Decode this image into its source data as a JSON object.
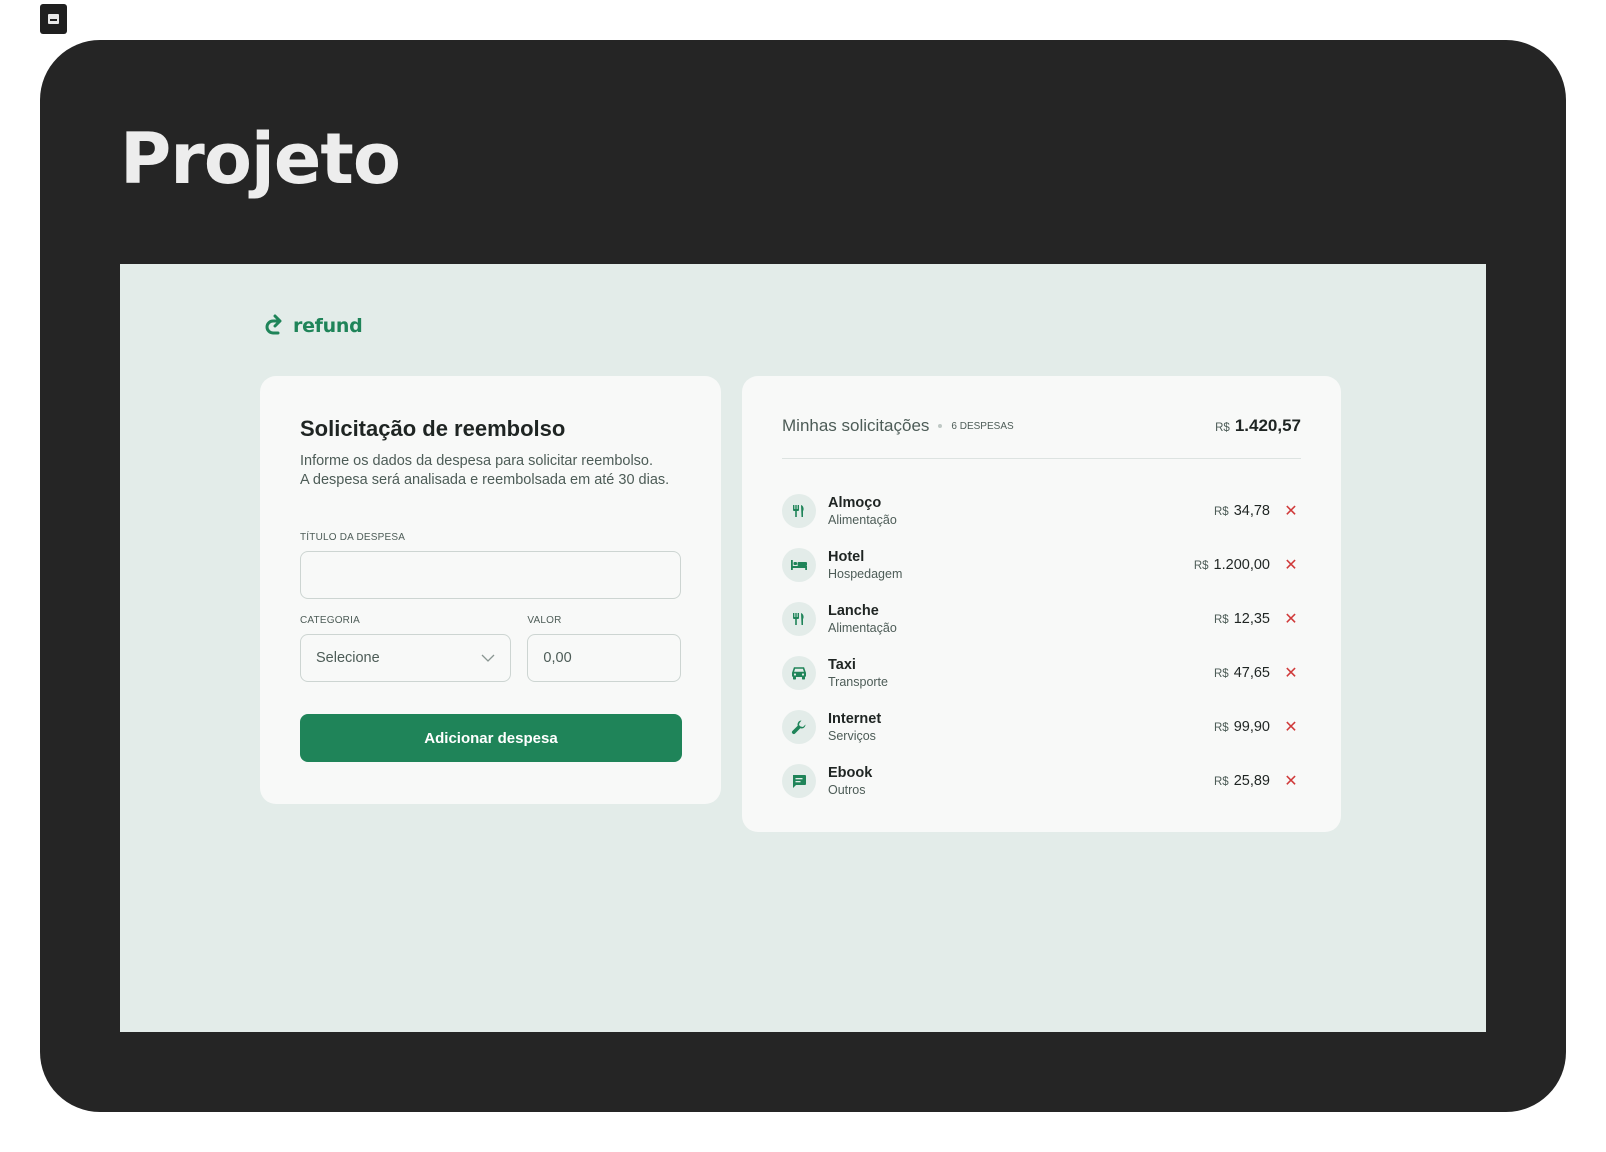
{
  "page": {
    "heading": "Projeto"
  },
  "app": {
    "brand": "refund",
    "accent": "#1f8459"
  },
  "form": {
    "title": "Solicitação de reembolso",
    "description_line1": "Informe os dados da despesa para solicitar reembolso.",
    "description_line2": "A despesa será analisada e reembolsada em até 30 dias.",
    "title_label": "TÍTULO DA DESPESA",
    "title_value": "",
    "category_label": "CATEGORIA",
    "category_value": "Selecione",
    "amount_label": "VALOR",
    "amount_placeholder": "0,00",
    "submit_label": "Adicionar despesa"
  },
  "list": {
    "title": "Minhas solicitações",
    "count": "6 DESPESAS",
    "currency": "R$",
    "total": "1.420,57",
    "items": [
      {
        "name": "Almoço",
        "category": "Alimentação",
        "currency": "R$",
        "value": "34,78",
        "icon": "utensils-icon"
      },
      {
        "name": "Hotel",
        "category": "Hospedagem",
        "currency": "R$",
        "value": "1.200,00",
        "icon": "bed-icon"
      },
      {
        "name": "Lanche",
        "category": "Alimentação",
        "currency": "R$",
        "value": "12,35",
        "icon": "utensils-icon"
      },
      {
        "name": "Taxi",
        "category": "Transporte",
        "currency": "R$",
        "value": "47,65",
        "icon": "car-icon"
      },
      {
        "name": "Internet",
        "category": "Serviços",
        "currency": "R$",
        "value": "99,90",
        "icon": "wrench-icon"
      },
      {
        "name": "Ebook",
        "category": "Outros",
        "currency": "R$",
        "value": "25,89",
        "icon": "message-icon"
      }
    ]
  }
}
